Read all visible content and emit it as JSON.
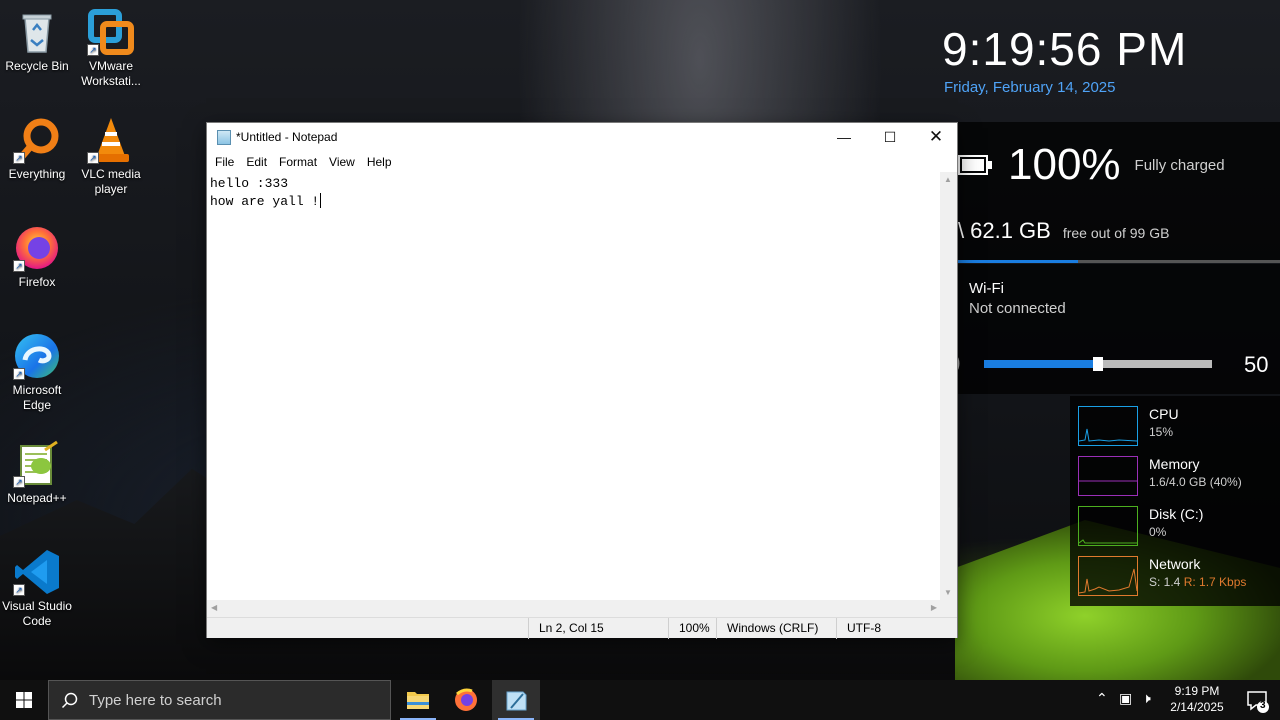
{
  "desktop": {
    "icons": [
      {
        "label": "Recycle Bin"
      },
      {
        "label": "VMware Workstati..."
      },
      {
        "label": "Everything"
      },
      {
        "label": "VLC media player"
      },
      {
        "label": "Firefox"
      },
      {
        "label": "Microsoft Edge"
      },
      {
        "label": "Notepad++"
      },
      {
        "label": "Visual Studio Code"
      }
    ]
  },
  "info_panel": {
    "clock": "9:19:56 PM",
    "date": "Friday, February 14, 2025",
    "battery": {
      "percent": "100%",
      "status": "Fully charged"
    },
    "disk": {
      "free": "62.1 GB",
      "detail": "free out of 99 GB",
      "used_fraction": 0.373
    },
    "wifi": {
      "title": "Wi-Fi",
      "status": "Not connected"
    },
    "volume": {
      "value": "50",
      "level": 0.5
    }
  },
  "performance": [
    {
      "name": "CPU",
      "value": "15%",
      "color": "#1aa0e6"
    },
    {
      "name": "Memory",
      "value": "1.6/4.0 GB (40%)",
      "color": "#9b2fb8"
    },
    {
      "name": "Disk (C:)",
      "value": "0%",
      "color": "#4caf1f"
    },
    {
      "name": "Network",
      "value_s": "S: 1.4",
      "value_r": "R: 1.7 Kbps",
      "color": "#e07a2e"
    }
  ],
  "notepad": {
    "title": "*Untitled - Notepad",
    "menu": [
      "File",
      "Edit",
      "Format",
      "View",
      "Help"
    ],
    "lines": [
      "hello :333",
      "how are yall !"
    ],
    "status": {
      "position": "Ln 2, Col 15",
      "zoom": "100%",
      "line_ending": "Windows (CRLF)",
      "encoding": "UTF-8"
    }
  },
  "taskbar": {
    "search_placeholder": "Type here to search",
    "time": "9:19 PM",
    "date": "2/14/2025",
    "notification_count": "3"
  }
}
